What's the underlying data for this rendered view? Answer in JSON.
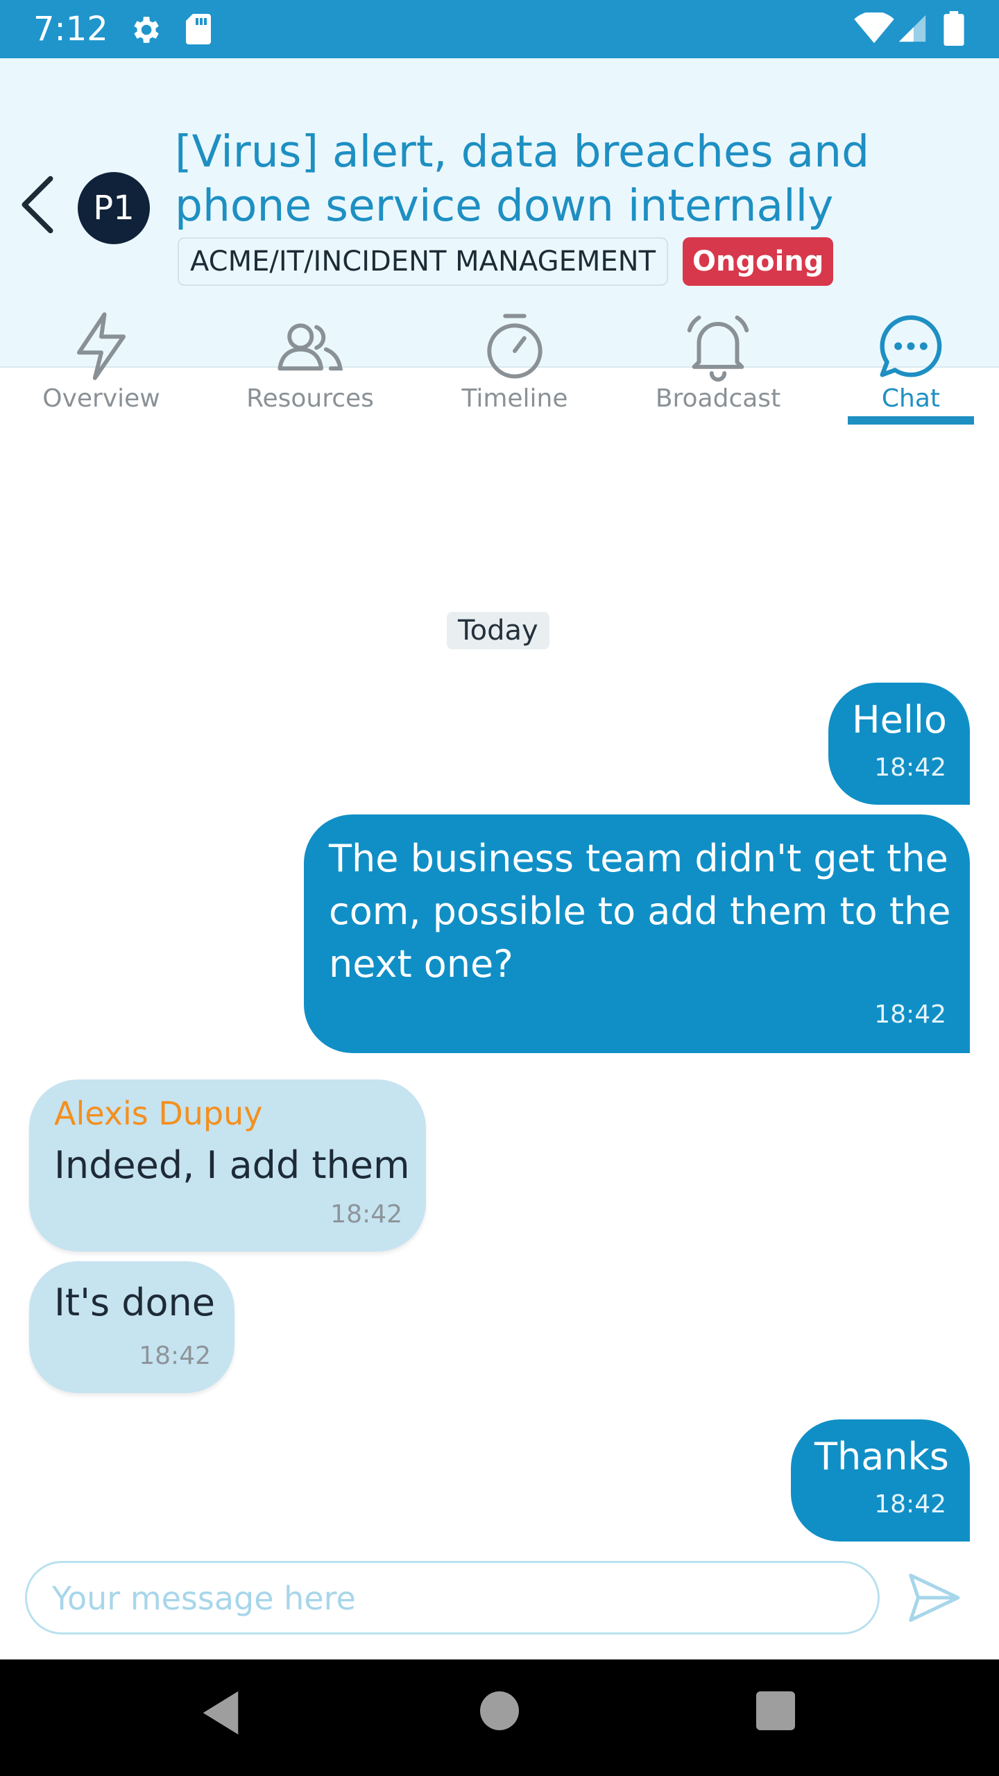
{
  "status_bar": {
    "time": "7:12",
    "bg_color": "#1f95cc"
  },
  "header": {
    "title": "[Virus] alert, data breaches and phone service down internally",
    "priority": "P1",
    "path": "ACME/IT/INCIDENT MANAGEMENT",
    "status": "Ongoing",
    "accent_color": "#1e8fc2",
    "status_color": "#d8384b"
  },
  "tabs": [
    {
      "label": "Overview",
      "icon": "lightning-icon",
      "active": false
    },
    {
      "label": "Resources",
      "icon": "people-icon",
      "active": false
    },
    {
      "label": "Timeline",
      "icon": "stopwatch-icon",
      "active": false
    },
    {
      "label": "Broadcast",
      "icon": "bell-icon",
      "active": false
    },
    {
      "label": "Chat",
      "icon": "chat-bubble-icon",
      "active": true
    }
  ],
  "chat": {
    "date_separator": "Today",
    "messages": [
      {
        "direction": "out",
        "text": "Hello",
        "time": "18:42"
      },
      {
        "direction": "out",
        "text": "The business team didn't get the com, possible to add them to the next one?",
        "time": "18:42"
      },
      {
        "direction": "in",
        "sender": "Alexis Dupuy",
        "text": "Indeed, I add them",
        "time": "18:42"
      },
      {
        "direction": "in",
        "text": "It's done",
        "time": "18:42"
      },
      {
        "direction": "out",
        "text": "Thanks",
        "time": "18:42"
      }
    ]
  },
  "composer": {
    "placeholder": "Your message here",
    "value": ""
  }
}
